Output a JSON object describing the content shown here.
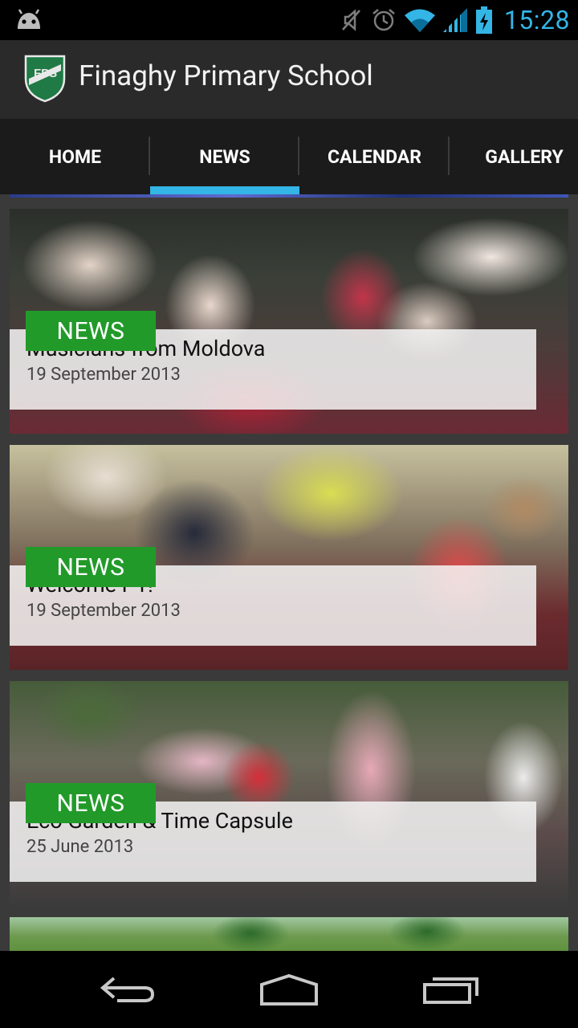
{
  "status_bar": {
    "time": "15:28",
    "icons": [
      "android-debug-icon",
      "mute-icon",
      "alarm-icon",
      "wifi-icon",
      "signal-icon",
      "battery-charging-icon"
    ]
  },
  "action_bar": {
    "title": "Finaghy Primary School",
    "logo_icon": "school-crest-icon",
    "logo_text": "FPS"
  },
  "tabs": [
    {
      "label": "HOME",
      "selected": false
    },
    {
      "label": "NEWS",
      "selected": true
    },
    {
      "label": "CALENDAR",
      "selected": false
    },
    {
      "label": "GALLERY",
      "selected": false
    }
  ],
  "accent_color": "#33b5e5",
  "tag_color": "#229a2a",
  "news": [
    {
      "tag": "NEWS",
      "title": "Musicians from Moldova",
      "date": "19 September 2013"
    },
    {
      "tag": "NEWS",
      "title": "Welcome P1!",
      "date": "19 September 2013"
    },
    {
      "tag": "NEWS",
      "title": "Eco Garden & Time Capsule",
      "date": "25 June 2013"
    }
  ],
  "nav_bar": {
    "icons": [
      "back-icon",
      "home-icon",
      "recents-icon"
    ]
  }
}
